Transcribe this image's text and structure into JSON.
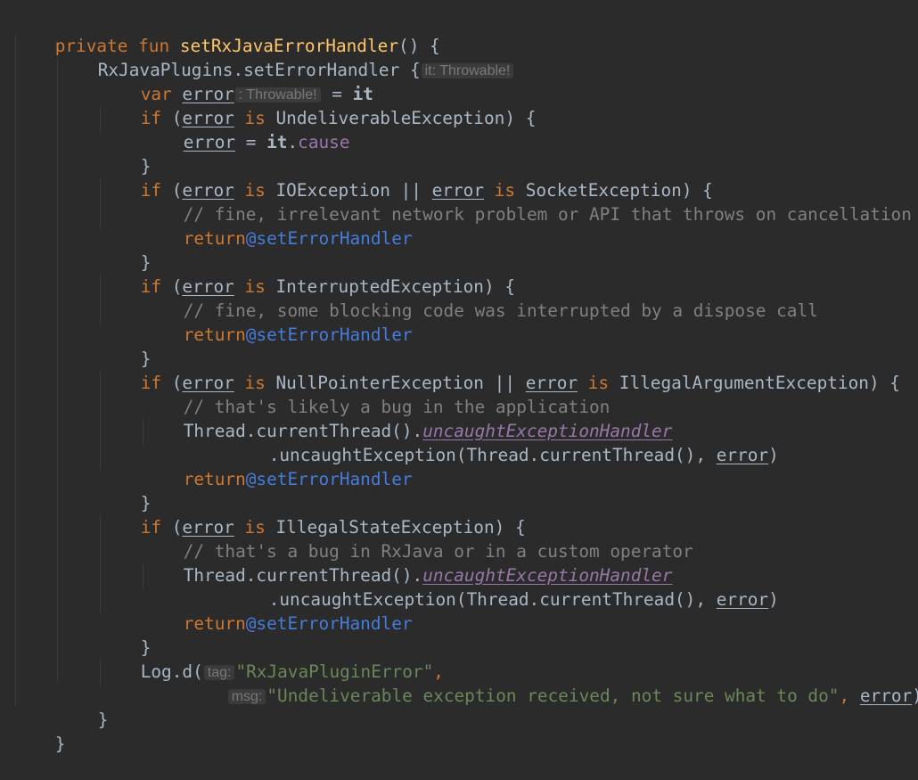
{
  "code": {
    "l1": {
      "kw1": "private",
      "kw2": "fun",
      "name": "setRxJavaErrorHandler",
      "rest": "() {"
    },
    "l2": {
      "obj": "RxJavaPlugins.setErrorHandler",
      "brace": " {",
      "hint": "it: Throwable!"
    },
    "l3": {
      "kw": "var",
      "var": "error",
      "hint": ": Throwable!",
      "eq": " = ",
      "it": "it"
    },
    "l4": {
      "kw": "if",
      "open": " (",
      "var": "error",
      "is": " is ",
      "type": "UndeliverableException",
      "close": ") {"
    },
    "l5": {
      "var": "error",
      "eq": " = ",
      "it": "it",
      "dot": ".",
      "prop": "cause"
    },
    "l6": {
      "brace": "}"
    },
    "l7": {
      "kw": "if",
      "open": " (",
      "var1": "error",
      "is1": " is ",
      "type1": "IOException || ",
      "var2": "error",
      "is2": " is ",
      "type2": "SocketException",
      "close": ") {"
    },
    "l8": {
      "comment": "// fine, irrelevant network problem or API that throws on cancellation"
    },
    "l9": {
      "kw": "return",
      "label": "@setErrorHandler"
    },
    "l10": {
      "brace": "}"
    },
    "l11": {
      "kw": "if",
      "open": " (",
      "var": "error",
      "is": " is ",
      "type": "InterruptedException",
      "close": ") {"
    },
    "l12": {
      "comment": "// fine, some blocking code was interrupted by a dispose call"
    },
    "l13": {
      "kw": "return",
      "label": "@setErrorHandler"
    },
    "l14": {
      "brace": "}"
    },
    "l15": {
      "kw": "if",
      "open": " (",
      "var1": "error",
      "is1": " is ",
      "type1": "NullPointerException || ",
      "var2": "error",
      "is2": " is ",
      "type2": "IllegalArgumentException",
      "close": ") {"
    },
    "l16": {
      "comment": "// that's likely a bug in the application"
    },
    "l17": {
      "obj": "Thread.currentThread().",
      "prop": "uncaughtExceptionHandler"
    },
    "l18": {
      "call": ".uncaughtException(Thread.currentThread(), ",
      "var": "error",
      "close": ")"
    },
    "l19": {
      "kw": "return",
      "label": "@setErrorHandler"
    },
    "l20": {
      "brace": "}"
    },
    "l21": {
      "kw": "if",
      "open": " (",
      "var": "error",
      "is": " is ",
      "type": "IllegalStateException",
      "close": ") {"
    },
    "l22": {
      "comment": "// that's a bug in RxJava or in a custom operator"
    },
    "l23": {
      "obj": "Thread.currentThread().",
      "prop": "uncaughtExceptionHandler"
    },
    "l24": {
      "call": ".uncaughtException(Thread.currentThread(), ",
      "var": "error",
      "close": ")"
    },
    "l25": {
      "kw": "return",
      "label": "@setErrorHandler"
    },
    "l26": {
      "brace": "}"
    },
    "l27": {
      "call": "Log.d(",
      "hint": "tag:",
      "str": "\"RxJavaPluginError\"",
      "comma": ","
    },
    "l28": {
      "hint": "msg:",
      "str": "\"Undeliverable exception received, not sure what to do\"",
      "comma": ", ",
      "var": "error",
      "close": ")"
    },
    "l29": {
      "brace": "}"
    },
    "l30": {
      "brace": "}"
    }
  }
}
